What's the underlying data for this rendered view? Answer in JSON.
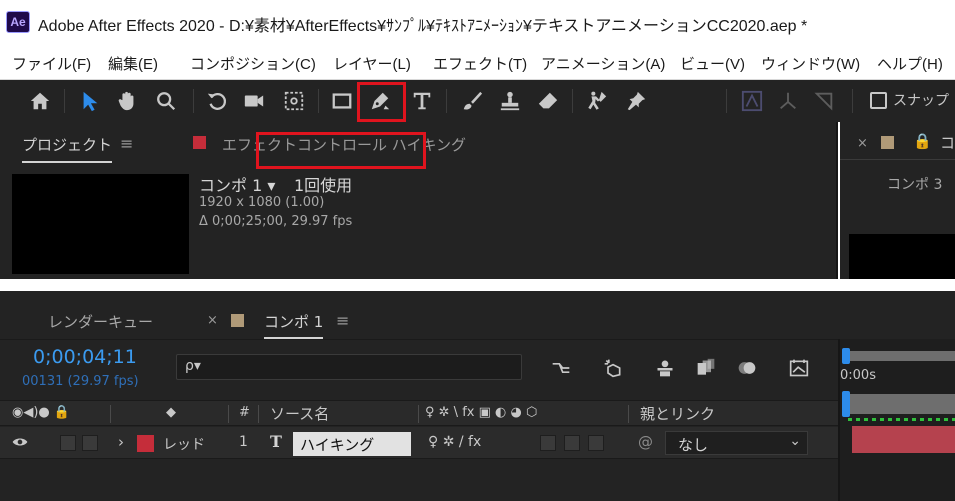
{
  "app": {
    "logo": "Ae",
    "title": "Adobe After Effects 2020 - D:¥素材¥AfterEffects¥ｻﾝﾌﾟﾙ¥ﾃｷｽﾄｱﾆﾒｰｼｮﾝ¥テキストアニメーションCC2020.aep *"
  },
  "menu": {
    "items": [
      "ファイル(F)",
      "編集(E)",
      "コンポジション(C)",
      "レイヤー(L)",
      "エフェクト(T)",
      "アニメーション(A)",
      "ビュー(V)",
      "ウィンドウ(W)",
      "ヘルプ(H)"
    ]
  },
  "toolbar": {
    "tools": [
      "home-icon",
      "selection-tool-icon",
      "hand-tool-icon",
      "zoom-tool-icon",
      "rotation-tool-icon",
      "camera-tool-icon",
      "pan-behind-tool-icon",
      "rectangle-tool-icon",
      "pen-tool-icon",
      "type-tool-icon",
      "brush-tool-icon",
      "clone-stamp-tool-icon",
      "eraser-tool-icon",
      "roto-brush-tool-icon",
      "puppet-pin-tool-icon"
    ],
    "active_tool": "selection-tool-icon",
    "highlighted_tool": "pen-tool-icon",
    "snap_label": "スナップ",
    "highlight_color": "#e0141e",
    "accent_color": "#2d8ceb"
  },
  "project_panel": {
    "tab_label": "プロジェクト",
    "menu_glyph": "≡",
    "effect_controls_label": "エフェクトコントロール ハイキング",
    "effect_controls_color": "#c52d3a",
    "comp_name": "コンポ 1 ▾",
    "comp_usage": "1回使用",
    "comp_resolution": "1920 x 1080 (1.00)",
    "comp_duration": "Δ 0;00;25;00, 29.97 fps"
  },
  "viewer_panel": {
    "close_glyph": "×",
    "label_color": "#b09a78",
    "lock_glyph": "🔒",
    "cut_glyph": "コ",
    "comp_tab": "コンポ 3"
  },
  "timeline": {
    "render_queue_tab": "レンダーキュー",
    "close_glyph": "×",
    "comp_tab": "コンポ 1",
    "comp_color": "#b09a78",
    "menu_glyph": "≡",
    "timecode": "0;00;04;11",
    "frames": "00131 (29.97 fps)",
    "search_glyph": "ρ▾",
    "ruler_label": "0:00s",
    "headers": {
      "switches_glyph": "◉◀)● 🔒",
      "label_glyph": "◆",
      "number": "#",
      "source_name": "ソース名",
      "layer_switches": "♀ ✲ \\ fx ▣ ◐ ◕ ⬡",
      "parent": "親とリンク"
    },
    "layer": {
      "label_name": "レッド",
      "label_color": "#c52d3a",
      "number": "1",
      "type_glyph": "T",
      "name": "ハイキング",
      "switches": "♀ ✲ / fx",
      "parent_value": "なし",
      "bar_color": "#b5424e"
    }
  }
}
